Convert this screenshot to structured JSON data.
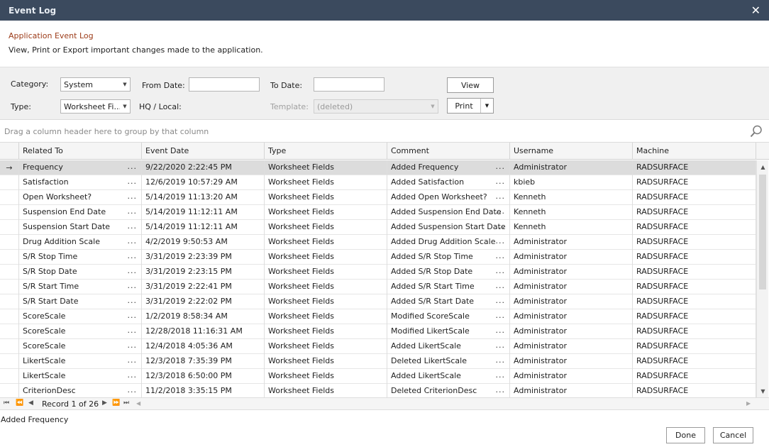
{
  "window": {
    "title": "Event Log",
    "close_glyph": "✕"
  },
  "header": {
    "title": "Application Event Log",
    "description": "View, Print or Export important changes made to the application."
  },
  "filters": {
    "category_label": "Category:",
    "category_value": "System",
    "type_label": "Type:",
    "type_value": "Worksheet Fi...",
    "from_date_label": "From Date:",
    "from_date_value": "",
    "to_date_label": "To Date:",
    "to_date_value": "",
    "hq_local_label": "HQ / Local:",
    "template_label": "Template:",
    "template_value": "(deleted)",
    "view_button": "View",
    "print_button": "Print"
  },
  "group_bar": {
    "hint": "Drag a column header here to group by that column"
  },
  "grid": {
    "columns": [
      "Related To",
      "Event Date",
      "Type",
      "Comment",
      "Username",
      "Machine"
    ],
    "rows": [
      [
        "Frequency",
        "9/22/2020 2:22:45 PM",
        "Worksheet Fields",
        "Added Frequency",
        "Administrator",
        "RADSURFACE"
      ],
      [
        "Satisfaction",
        "12/6/2019 10:57:29 AM",
        "Worksheet Fields",
        "Added Satisfaction",
        "kbieb",
        "RADSURFACE"
      ],
      [
        "Open Worksheet?",
        "5/14/2019 11:13:20 AM",
        "Worksheet Fields",
        "Added Open Worksheet?",
        "Kenneth",
        "RADSURFACE"
      ],
      [
        "Suspension End Date",
        "5/14/2019 11:12:11 AM",
        "Worksheet Fields",
        "Added Suspension End Date",
        "Kenneth",
        "RADSURFACE"
      ],
      [
        "Suspension Start Date",
        "5/14/2019 11:12:11 AM",
        "Worksheet Fields",
        "Added Suspension Start Date",
        "Kenneth",
        "RADSURFACE"
      ],
      [
        "Drug Addition Scale",
        "4/2/2019 9:50:53 AM",
        "Worksheet Fields",
        "Added Drug Addition Scale",
        "Administrator",
        "RADSURFACE"
      ],
      [
        "S/R Stop Time",
        "3/31/2019 2:23:39 PM",
        "Worksheet Fields",
        "Added S/R Stop Time",
        "Administrator",
        "RADSURFACE"
      ],
      [
        "S/R Stop Date",
        "3/31/2019 2:23:15 PM",
        "Worksheet Fields",
        "Added S/R Stop Date",
        "Administrator",
        "RADSURFACE"
      ],
      [
        "S/R Start Time",
        "3/31/2019 2:22:41 PM",
        "Worksheet Fields",
        "Added S/R Start Time",
        "Administrator",
        "RADSURFACE"
      ],
      [
        "S/R Start Date",
        "3/31/2019 2:22:02 PM",
        "Worksheet Fields",
        "Added S/R Start Date",
        "Administrator",
        "RADSURFACE"
      ],
      [
        "ScoreScale",
        "1/2/2019 8:58:34 AM",
        "Worksheet Fields",
        "Modified ScoreScale",
        "Administrator",
        "RADSURFACE"
      ],
      [
        "ScoreScale",
        "12/28/2018 11:16:31 AM",
        "Worksheet Fields",
        "Modified LikertScale",
        "Administrator",
        "RADSURFACE"
      ],
      [
        "ScoreScale",
        "12/4/2018 4:05:36 AM",
        "Worksheet Fields",
        "Added LikertScale",
        "Administrator",
        "RADSURFACE"
      ],
      [
        "LikertScale",
        "12/3/2018 7:35:39 PM",
        "Worksheet Fields",
        "Deleted LikertScale",
        "Administrator",
        "RADSURFACE"
      ],
      [
        "LikertScale",
        "12/3/2018 6:50:00 PM",
        "Worksheet Fields",
        "Added LikertScale",
        "Administrator",
        "RADSURFACE"
      ],
      [
        "CriterionDesc",
        "11/2/2018 3:35:15 PM",
        "Worksheet Fields",
        "Deleted CriterionDesc",
        "Administrator",
        "RADSURFACE"
      ]
    ],
    "selected_row_marker": "→",
    "ellipsis": "..."
  },
  "navigator": {
    "record_text": "Record 1 of 26"
  },
  "status": {
    "text": "Added Frequency"
  },
  "footer": {
    "done_button": "Done",
    "cancel_button": "Cancel"
  },
  "colors": {
    "titlebar": "#3b4a5e",
    "header_accent": "#9c3b18"
  },
  "icons": {
    "search": "search-icon",
    "close": "close-icon"
  }
}
